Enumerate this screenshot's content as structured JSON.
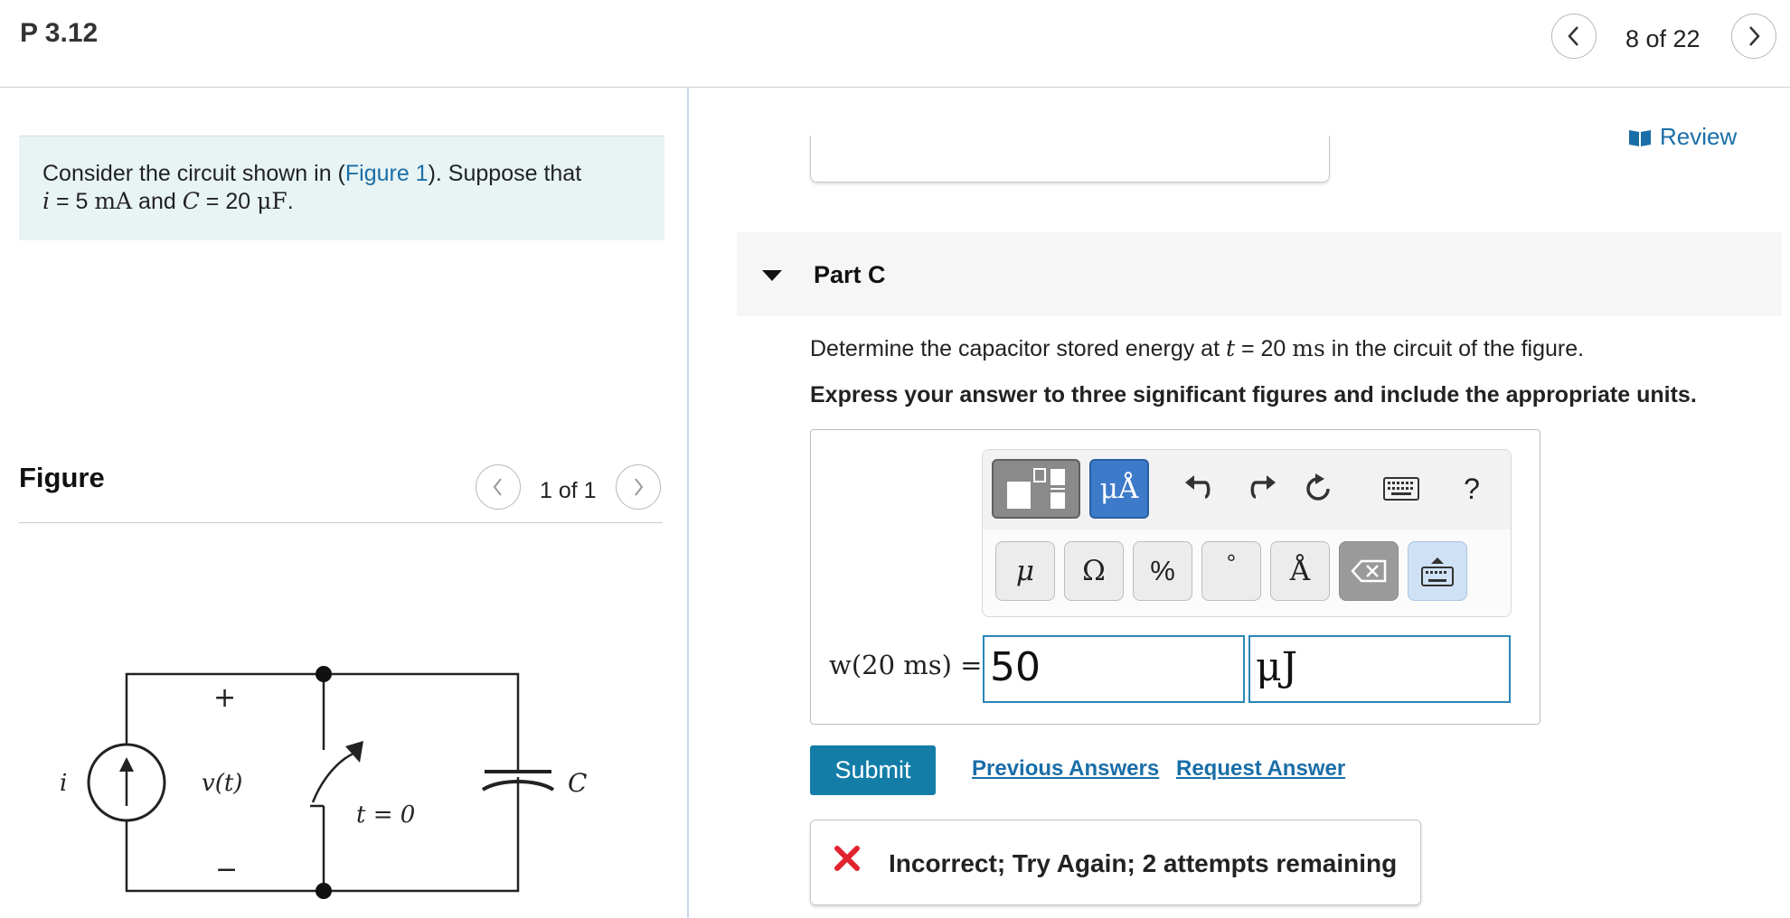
{
  "header": {
    "title": "P 3.12",
    "nav_count": "8 of 22"
  },
  "problem": {
    "line1_prefix": "Consider the circuit shown in (",
    "figure_link": "Figure 1",
    "line1_suffix": "). Suppose that",
    "i_symbol": "i",
    "i_value": " = 5 ",
    "i_unit": "mA",
    "and_text": " and ",
    "c_symbol": "C",
    "c_value": " = 20 ",
    "c_unit": "μF",
    "period": "."
  },
  "figure": {
    "heading": "Figure",
    "count": "1 of 1",
    "labels": {
      "source": "i",
      "voltage": "v(t)",
      "plus": "+",
      "minus": "−",
      "switch_time": "t = 0",
      "capacitor": "C"
    }
  },
  "right": {
    "review": "Review",
    "part_title": "Part C",
    "question_prefix": "Determine the capacitor stored energy at ",
    "question_t": "t",
    "question_mid": " = 20 ",
    "question_unit": "ms",
    "question_suffix": " in the circuit of the figure.",
    "instruction": "Express your answer to three significant figures and include the appropriate units."
  },
  "toolbar": {
    "units_label": "μÅ",
    "help": "?",
    "keys": {
      "mu": "μ",
      "omega": "Ω",
      "percent": "%",
      "degree": "°",
      "angstrom": "Å"
    }
  },
  "answer": {
    "label": "w(20 ms) =",
    "value": "50",
    "unit": "μJ"
  },
  "actions": {
    "submit": "Submit",
    "previous_answers": "Previous Answers",
    "request_answer": "Request Answer"
  },
  "feedback": {
    "message": "Incorrect; Try Again; 2 attempts remaining"
  },
  "colors": {
    "accent": "#137da8",
    "link": "#1a6ea8",
    "error": "#e0242e",
    "problem_bg": "#e8f4f4"
  }
}
